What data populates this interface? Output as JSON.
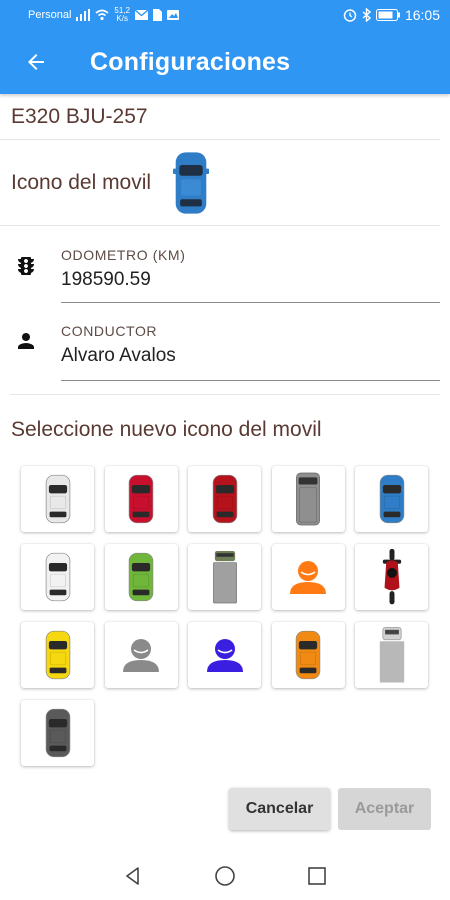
{
  "status_bar": {
    "carrier": "Personal",
    "speed_value": "51,2",
    "speed_unit": "K/s",
    "time": "16:05"
  },
  "app_bar": {
    "title": "Configuraciones",
    "back_icon": "arrow-back-icon"
  },
  "vehicle": {
    "plate": "E320 BJU-257",
    "icon_label": "Icono del movil",
    "current_icon": "car-blue"
  },
  "fields": {
    "odometer": {
      "label": "ODOMETRO (KM)",
      "value": "198590.59",
      "icon": "traffic-light-icon"
    },
    "driver": {
      "label": "CONDUCTOR",
      "value": "Alvaro Avalos",
      "icon": "person-icon"
    }
  },
  "selector": {
    "title": "Seleccione nuevo icono del movil",
    "options": [
      {
        "name": "car-white",
        "color": "#e8e8e8"
      },
      {
        "name": "car-red",
        "color": "#c8102e"
      },
      {
        "name": "car-red-2",
        "color": "#b5121b"
      },
      {
        "name": "van-gray",
        "color": "#8f8f8f"
      },
      {
        "name": "car-blue",
        "color": "#2f7dc6"
      },
      {
        "name": "car-white-2",
        "color": "#f2f2f2"
      },
      {
        "name": "car-green",
        "color": "#6fb63a"
      },
      {
        "name": "truck-gray",
        "color": "#a0a0a0"
      },
      {
        "name": "person-orange",
        "color": "#ff7a12"
      },
      {
        "name": "motorcycle-red",
        "color": "#b0101a"
      },
      {
        "name": "car-yellow",
        "color": "#f5d80f"
      },
      {
        "name": "person-gray",
        "color": "#8a8a8a"
      },
      {
        "name": "person-blue",
        "color": "#3b1fe0"
      },
      {
        "name": "car-orange",
        "color": "#f08a12"
      },
      {
        "name": "truck-box-gray",
        "color": "#b8b8b8"
      },
      {
        "name": "car-darkgray",
        "color": "#5a5a5a"
      }
    ]
  },
  "actions": {
    "cancel": "Cancelar",
    "accept": "Aceptar"
  },
  "colors": {
    "primary": "#2f96f3",
    "label_brown": "#5a3a33"
  }
}
